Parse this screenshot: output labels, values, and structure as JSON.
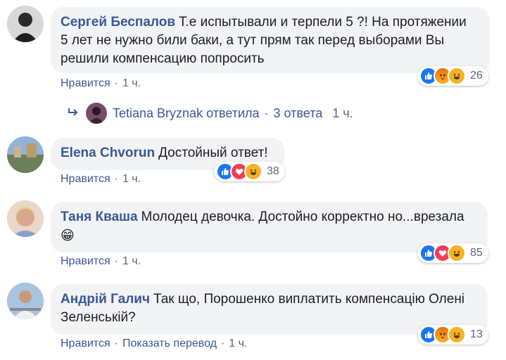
{
  "comments": [
    {
      "author": "Сергей Беспалов",
      "text_line1": "Т.е испытывали и терпели 5 ?! На протяжении",
      "text_line2": "5 лет не нужно били баки, а тут прям так перед выборами Вы",
      "text_line3": "решили компенсацию попросить",
      "like_label": "Нравится",
      "time": "1 ч.",
      "reaction_count": "26",
      "reactions": [
        "like-icon",
        "angry-icon",
        "haha-icon"
      ]
    },
    {
      "author": "Elena Chvorun",
      "text": "Достойный ответ!",
      "like_label": "Нравится",
      "time": "1 ч.",
      "reaction_count": "38",
      "reactions": [
        "like-icon",
        "love-icon",
        "haha-icon"
      ]
    },
    {
      "author": "Таня Кваша",
      "text": "Молодец девочка. Достойно корректно но...врезала",
      "emoji": "😁",
      "like_label": "Нравится",
      "time": "1 ч.",
      "reaction_count": "85",
      "reactions": [
        "like-icon",
        "love-icon",
        "haha-icon"
      ]
    },
    {
      "author": "Андрій Галич",
      "text_line1": "Так що, Порошенко виплатить компенсацію Олені",
      "text_line2": "Зеленській?",
      "like_label": "Нравится",
      "translate_label": "Показать перевод",
      "time": "1 ч.",
      "reaction_count": "13",
      "reactions": [
        "like-icon",
        "angry-icon",
        "haha-icon"
      ]
    }
  ],
  "reply_summary": {
    "replier": "Tetiana Bryznak",
    "action": "ответила",
    "count": "3 ответа",
    "time": "1 ч."
  },
  "colors": {
    "link": "#385898",
    "bubble": "#f2f3f5",
    "meta": "#606770",
    "like": "#1877f2",
    "love": "#f33e58",
    "haha": "#f7b125"
  }
}
